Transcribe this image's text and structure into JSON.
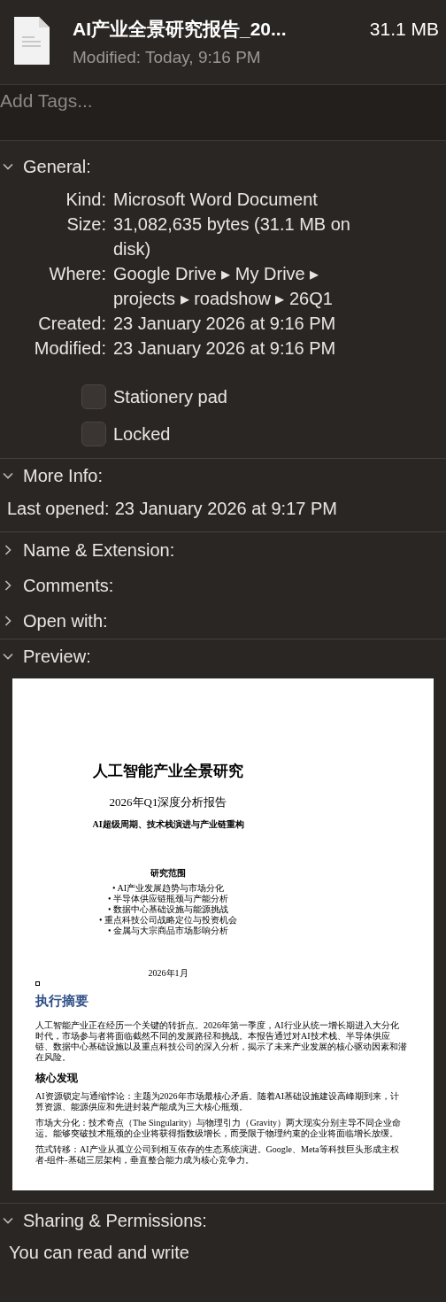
{
  "header": {
    "title": "AI产业全景研究报告_20...",
    "size": "31.1 MB",
    "modified": "Modified: Today, 9:16 PM"
  },
  "tags": {
    "placeholder": "Add Tags..."
  },
  "sections": [
    {
      "kind": "general",
      "title": "General:",
      "expanded": true,
      "rows": [
        {
          "label": "Kind:",
          "value": "Microsoft Word Document"
        },
        {
          "label": "Size:",
          "value": "31,082,635 bytes (31.1 MB on disk)"
        },
        {
          "label": "Where:",
          "value": "Google Drive ▸ My Drive ▸ projects ▸ roadshow ▸ 26Q1"
        },
        {
          "label": "Created:",
          "value": "23 January 2026 at 9:16 PM"
        },
        {
          "label": "Modified:",
          "value": "23 January 2026 at 9:16 PM"
        }
      ],
      "checkboxes": [
        {
          "label": "Stationery pad",
          "checked": false
        },
        {
          "label": "Locked",
          "checked": false
        }
      ]
    },
    {
      "kind": "more_info",
      "title": "More Info:",
      "expanded": true,
      "rows": [
        {
          "label": "Last opened:",
          "value": "23 January 2026 at 9:17 PM"
        }
      ]
    },
    {
      "kind": "collapsed",
      "title": "Name & Extension:",
      "expanded": false
    },
    {
      "kind": "collapsed",
      "title": "Comments:",
      "expanded": false
    },
    {
      "kind": "collapsed",
      "title": "Open with:",
      "expanded": false
    },
    {
      "kind": "preview",
      "title": "Preview:",
      "expanded": true,
      "document": {
        "title": "人工智能产业全景研究",
        "subtitle": "2026年Q1深度分析报告",
        "tagline": "AI超级周期、技术栈演进与产业链重构",
        "scope_title": "研究范围",
        "scope_items": [
          "• AI产业发展趋势与市场分化",
          "• 半导体供应链瓶颈与产能分析",
          "• 数据中心基础设施与能源挑战",
          "• 重点科技公司战略定位与投资机会",
          "• 金属与大宗商品市场影响分析"
        ],
        "date": "2026年1月",
        "summary_heading": "执行摘要",
        "summary": "人工智能产业正在经历一个关键的转折点。2026年第一季度，AI行业从统一增长期进入大分化时代，市场参与者将面临截然不同的发展路径和挑战。本报告通过对AI技术栈、半导体供应链、数据中心基础设施以及重点科技公司的深入分析，揭示了未来产业发展的核心驱动因素和潜在风险。",
        "findings_heading": "核心发现",
        "findings": [
          "AI资源锁定与通缩悖论：主题为2026年市场最核心矛盾。随着AI基础设施建设高峰期到来，计算资源、能源供应和先进封装产能成为三大核心瓶颈。",
          "市场大分化：技术奇点（The Singularity）与物理引力（Gravity）两大现实分别主导不同企业命运。能够突破技术瓶颈的企业将获得指数级增长，而受限于物理约束的企业将面临增长放缓。",
          "范式转移：AI产业从孤立公司到相互依存的生态系统演进。Google、Meta等科技巨头形成主权者-组件-基础三层架构，垂直整合能力成为核心竞争力。"
        ]
      }
    },
    {
      "kind": "sharing",
      "title": "Sharing & Permissions:",
      "expanded": true,
      "text": "You can read and write"
    }
  ]
}
